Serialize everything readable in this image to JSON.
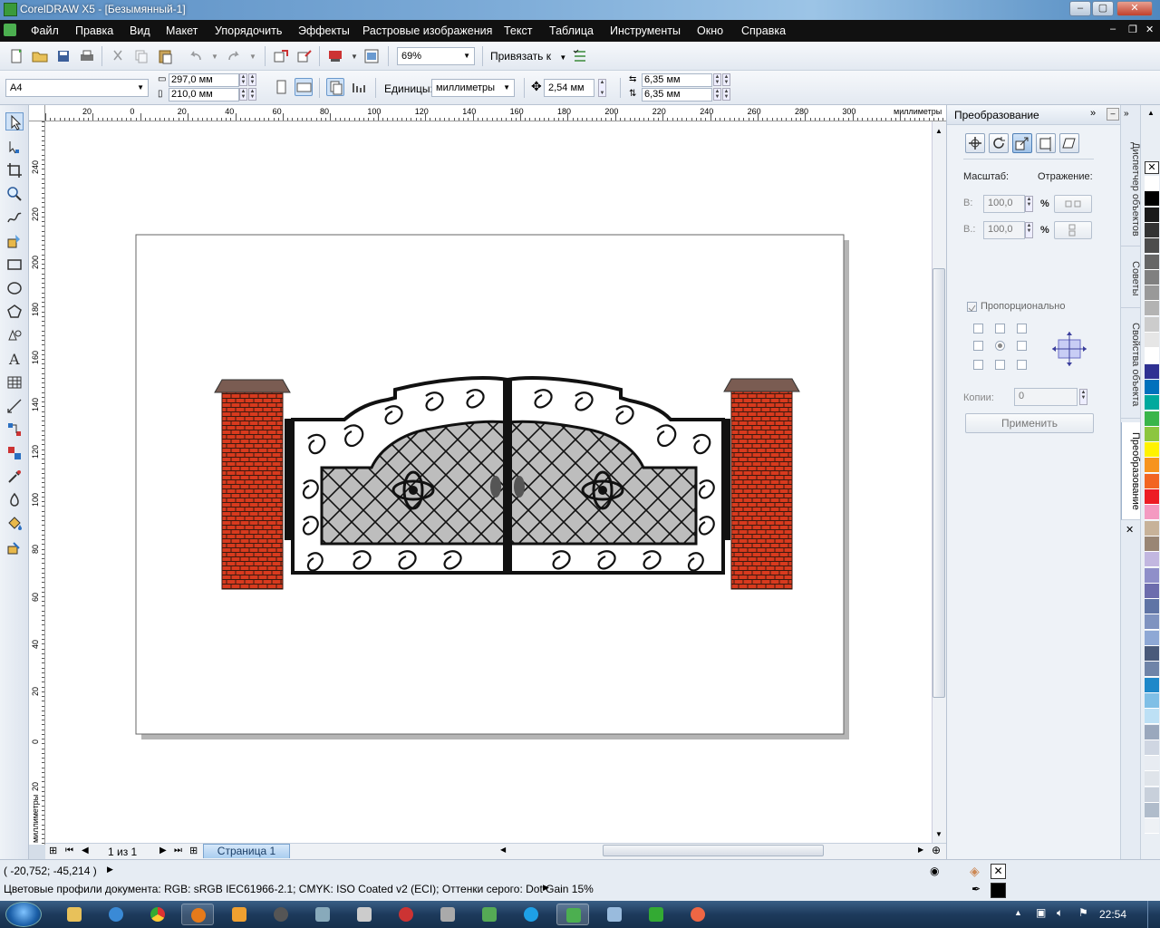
{
  "window": {
    "title": "CorelDRAW X5 - [Безымянный-1]"
  },
  "menu": {
    "items": [
      "Файл",
      "Правка",
      "Вид",
      "Макет",
      "Упорядочить",
      "Эффекты",
      "Растровые изображения",
      "Текст",
      "Таблица",
      "Инструменты",
      "Окно",
      "Справка"
    ]
  },
  "toolbar1": {
    "zoom": "69%",
    "snap_label": "Привязать к"
  },
  "toolbar2": {
    "paper_size": "A4",
    "width": "297,0 мм",
    "height": "210,0 мм",
    "units_label": "Единицы:",
    "units_value": "миллиметры",
    "nudge": "2,54 мм",
    "dup_x": "6,35 мм",
    "dup_y": "6,35 мм"
  },
  "rulers": {
    "top_ticks": [
      "20",
      "0",
      "20",
      "40",
      "60",
      "80",
      "100",
      "120",
      "140",
      "160",
      "180",
      "200",
      "220",
      "240",
      "260",
      "280",
      "300"
    ],
    "top_unit": "миллиметры",
    "left_ticks": [
      "240",
      "220",
      "200",
      "180",
      "160",
      "140",
      "120",
      "100",
      "80",
      "60",
      "40",
      "20",
      "0",
      "20"
    ],
    "left_unit": "миллиметры"
  },
  "page_nav": {
    "counter": "1 из 1",
    "tab": "Страница 1"
  },
  "docker": {
    "title": "Преобразование",
    "scale_label": "Масштаб:",
    "mirror_label": "Отражение:",
    "h_label": "В:",
    "v_label": "В.:",
    "h_value": "100,0",
    "v_value": "100,0",
    "percent": "%",
    "proportional": "Пропорционально",
    "copies_label": "Копии:",
    "copies_value": "0",
    "apply": "Применить"
  },
  "side_tabs": [
    "Диспетчер объектов",
    "Советы",
    "Свойства объекта",
    "Преобразование"
  ],
  "palette": [
    "#ffffff",
    "#000000",
    "#1a1a1a",
    "#333333",
    "#4d4d4d",
    "#666666",
    "#808080",
    "#999999",
    "#b3b3b3",
    "#cccccc",
    "#e6e6e6",
    "#ffffff",
    "#2e3192",
    "#0071bc",
    "#00a99d",
    "#39b54a",
    "#8cc63f",
    "#fff200",
    "#f7941d",
    "#f26522",
    "#ed1c24",
    "#f49ac1",
    "#c7b299",
    "#998675",
    "#c2b7e0",
    "#8f8fc9",
    "#6d6dad",
    "#5f74a5",
    "#7f93c0",
    "#8ea8d5",
    "#4a5a7a",
    "#6f84a8",
    "#1e88c9",
    "#7fbfe6",
    "#bde0f5",
    "#9aa8bd",
    "#cfd6e2",
    "#e8ecf2",
    "#dfe4ea",
    "#c8d0db",
    "#b0bccb",
    "#eef1f5"
  ],
  "status": {
    "coords": "( -20,752; -45,214 )",
    "profiles": "Цветовые профили документа: RGB: sRGB IEC61966-2.1; CMYK: ISO Coated v2 (ECI); Оттенки серого: Dot Gain 15%"
  },
  "taskbar": {
    "time": "22:54"
  },
  "colors": {
    "brick": "#d83a1e",
    "cap": "#7a5c52",
    "gate_fill": "#bdbdbd",
    "accent": "#3c7fc4"
  }
}
